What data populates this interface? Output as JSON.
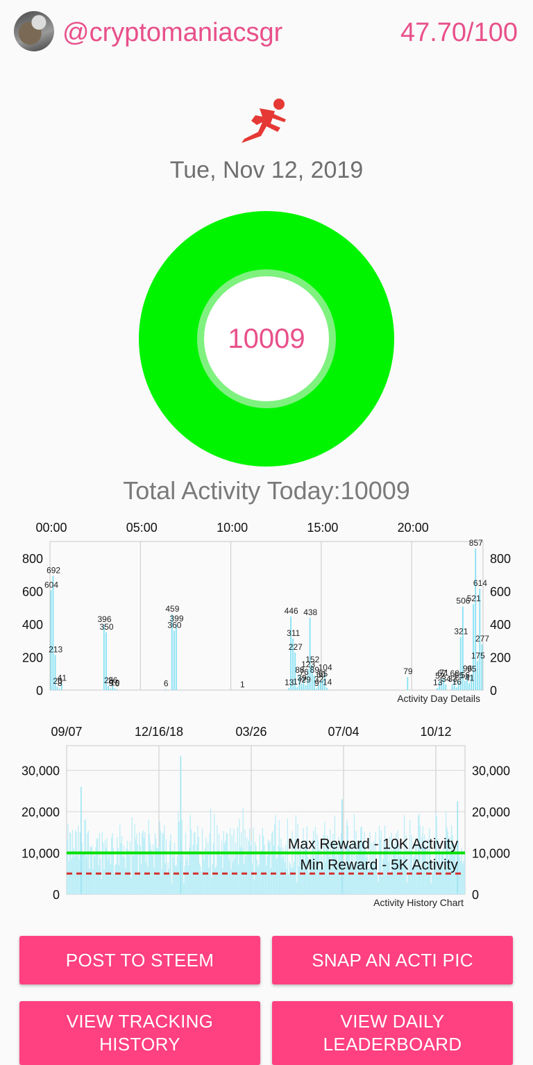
{
  "header": {
    "username": "@cryptomaniacsgr",
    "score": "47.70/100"
  },
  "icons": {
    "activity": "runner-icon",
    "avatar": "profile-photo"
  },
  "date": "Tue, Nov 12, 2019",
  "ring": {
    "value": "10009",
    "fill_color": "#00f400",
    "progress_fraction": 1.0
  },
  "total_activity": "Total Activity Today:10009",
  "colors": {
    "accent": "#e8508a",
    "button": "#ff4081",
    "bar": "#87e2f5",
    "ring": "#00f400"
  },
  "chart_data": [
    {
      "type": "bar",
      "title": "Activity Day Details",
      "x_tick_labels": [
        "00:00",
        "05:00",
        "10:00",
        "15:00",
        "20:00"
      ],
      "y_ticks": [
        "0",
        "200",
        "400",
        "600",
        "800"
      ],
      "ylim": [
        0,
        900
      ],
      "grid": true,
      "bars": [
        {
          "t": 0,
          "v": 604
        },
        {
          "t": 1,
          "v": 692
        },
        {
          "t": 2,
          "v": 213
        },
        {
          "t": 3,
          "v": 20
        },
        {
          "t": 4,
          "v": 8
        },
        {
          "t": 5,
          "v": 41
        },
        {
          "t": 25,
          "v": 396
        },
        {
          "t": 26,
          "v": 350
        },
        {
          "t": 27,
          "v": 25
        },
        {
          "t": 28,
          "v": 9
        },
        {
          "t": 29,
          "v": 26
        },
        {
          "t": 30,
          "v": 10
        },
        {
          "t": 31,
          "v": 6
        },
        {
          "t": 54,
          "v": 6
        },
        {
          "t": 57,
          "v": 459
        },
        {
          "t": 58,
          "v": 360
        },
        {
          "t": 59,
          "v": 399
        },
        {
          "t": 90,
          "v": 1
        },
        {
          "t": 112,
          "v": 13
        },
        {
          "t": 113,
          "v": 446
        },
        {
          "t": 114,
          "v": 311
        },
        {
          "t": 115,
          "v": 227
        },
        {
          "t": 116,
          "v": 17
        },
        {
          "t": 117,
          "v": 88
        },
        {
          "t": 118,
          "v": 39
        },
        {
          "t": 119,
          "v": 76
        },
        {
          "t": 120,
          "v": 29
        },
        {
          "t": 121,
          "v": 123
        },
        {
          "t": 122,
          "v": 438
        },
        {
          "t": 123,
          "v": 152
        },
        {
          "t": 124,
          "v": 89
        },
        {
          "t": 125,
          "v": 9
        },
        {
          "t": 126,
          "v": 32
        },
        {
          "t": 127,
          "v": 60
        },
        {
          "t": 128,
          "v": 65
        },
        {
          "t": 129,
          "v": 104
        },
        {
          "t": 130,
          "v": 14
        },
        {
          "t": 168,
          "v": 79
        },
        {
          "t": 168.5,
          "v": 0
        },
        {
          "t": 182,
          "v": 13
        },
        {
          "t": 183,
          "v": 52
        },
        {
          "t": 184,
          "v": 67
        },
        {
          "t": 185,
          "v": 71
        },
        {
          "t": 186,
          "v": 34
        },
        {
          "t": 189,
          "v": 33
        },
        {
          "t": 190,
          "v": 68
        },
        {
          "t": 191,
          "v": 16
        },
        {
          "t": 192,
          "v": 55
        },
        {
          "t": 193,
          "v": 321
        },
        {
          "t": 194,
          "v": 506
        },
        {
          "t": 195,
          "v": 56
        },
        {
          "t": 196,
          "v": 96
        },
        {
          "t": 197,
          "v": 41
        },
        {
          "t": 198,
          "v": 95
        },
        {
          "t": 199,
          "v": 521
        },
        {
          "t": 200,
          "v": 857
        },
        {
          "t": 201,
          "v": 175
        },
        {
          "t": 202,
          "v": 614
        },
        {
          "t": 203,
          "v": 277
        }
      ]
    },
    {
      "type": "area",
      "title": "Activity History Chart",
      "x_tick_labels": [
        "09/07",
        "12/16/18",
        "03/26",
        "07/04",
        "10/12"
      ],
      "y_ticks": [
        "0",
        "10,000",
        "20,000",
        "30,000"
      ],
      "ylim": [
        0,
        36000
      ],
      "grid": true,
      "reference_lines": [
        {
          "label": "Max Reward - 10K Activity",
          "value": 10000,
          "color": "#00e000",
          "style": "solid"
        },
        {
          "label": "Min Reward - 5K Activity",
          "value": 5000,
          "color": "#d32f2f",
          "style": "dashed"
        }
      ],
      "notable_peaks": [
        {
          "x_fraction": 0.035,
          "value": 26000
        },
        {
          "x_fraction": 0.285,
          "value": 33500
        },
        {
          "x_fraction": 0.69,
          "value": 23000
        },
        {
          "x_fraction": 0.98,
          "value": 22500
        }
      ],
      "typical_range": [
        6000,
        17000
      ]
    }
  ],
  "buttons": {
    "post": "POST TO STEEM",
    "snap": "SNAP AN ACTI PIC",
    "history_line1": "VIEW TRACKING",
    "history_line2": "HISTORY",
    "leaderboard_line1": "VIEW DAILY",
    "leaderboard_line2": "LEADERBOARD"
  }
}
